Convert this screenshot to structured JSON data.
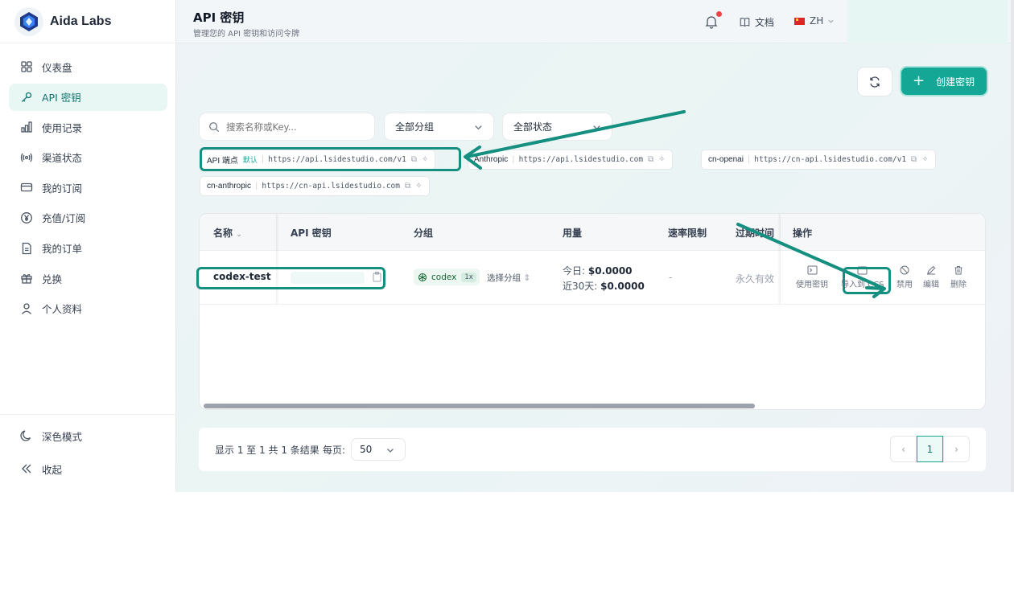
{
  "brand": {
    "name": "Aida Labs"
  },
  "sidebar": {
    "items": [
      {
        "label": "仪表盘",
        "icon": "dashboard-icon"
      },
      {
        "label": "API 密钥",
        "icon": "key-icon",
        "active": true
      },
      {
        "label": "使用记录",
        "icon": "bar-chart-icon"
      },
      {
        "label": "渠道状态",
        "icon": "broadcast-icon"
      },
      {
        "label": "我的订阅",
        "icon": "credit-card-icon"
      },
      {
        "label": "充值/订阅",
        "icon": "yen-coin-icon"
      },
      {
        "label": "我的订单",
        "icon": "document-icon"
      },
      {
        "label": "兑换",
        "icon": "gift-icon"
      },
      {
        "label": "个人资料",
        "icon": "user-icon"
      }
    ],
    "dark_mode": "深色模式",
    "collapse": "收起"
  },
  "header": {
    "title": "API 密钥",
    "subtitle": "管理您的 API 密钥和访问令牌",
    "docs": "文档",
    "lang": "ZH"
  },
  "toolbar": {
    "create_label": "创建密钥",
    "search_placeholder": "搜索名称或Key...",
    "group_filter": "全部分组",
    "status_filter": "全部状态"
  },
  "endpoints": [
    {
      "label": "API 端点",
      "default": "默认",
      "url": "https://api.lsidestudio.com/v1"
    },
    {
      "label": "Anthropic",
      "url": "https://api.lsidestudio.com"
    },
    {
      "label": "cn-openai",
      "url": "https://cn-api.lsidestudio.com/v1"
    },
    {
      "label": "cn-anthropic",
      "url": "https://cn-api.lsidestudio.com"
    }
  ],
  "table": {
    "columns": [
      "名称",
      "API 密钥",
      "分组",
      "用量",
      "速率限制",
      "过期时间",
      "操作"
    ],
    "rows": [
      {
        "name": "codex-test",
        "group": "codex",
        "multiplier": "1x",
        "select_group": "选择分组",
        "usage_today_label": "今日:",
        "usage_today": "$0.0000",
        "usage_30d_label": "近30天:",
        "usage_30d": "$0.0000",
        "rate_limit": "-",
        "expiry": "永久有效",
        "actions": [
          "使用密钥",
          "导入到 CCS",
          "禁用",
          "编辑",
          "删除"
        ]
      }
    ]
  },
  "footer": {
    "summary": "显示 1 至 1 共 1 条结果",
    "per_page_label": "每页:",
    "per_page": "50",
    "current_page": "1"
  },
  "colors": {
    "accent": "#14a796",
    "annotation": "#148f80",
    "alert": "#ef4444"
  }
}
